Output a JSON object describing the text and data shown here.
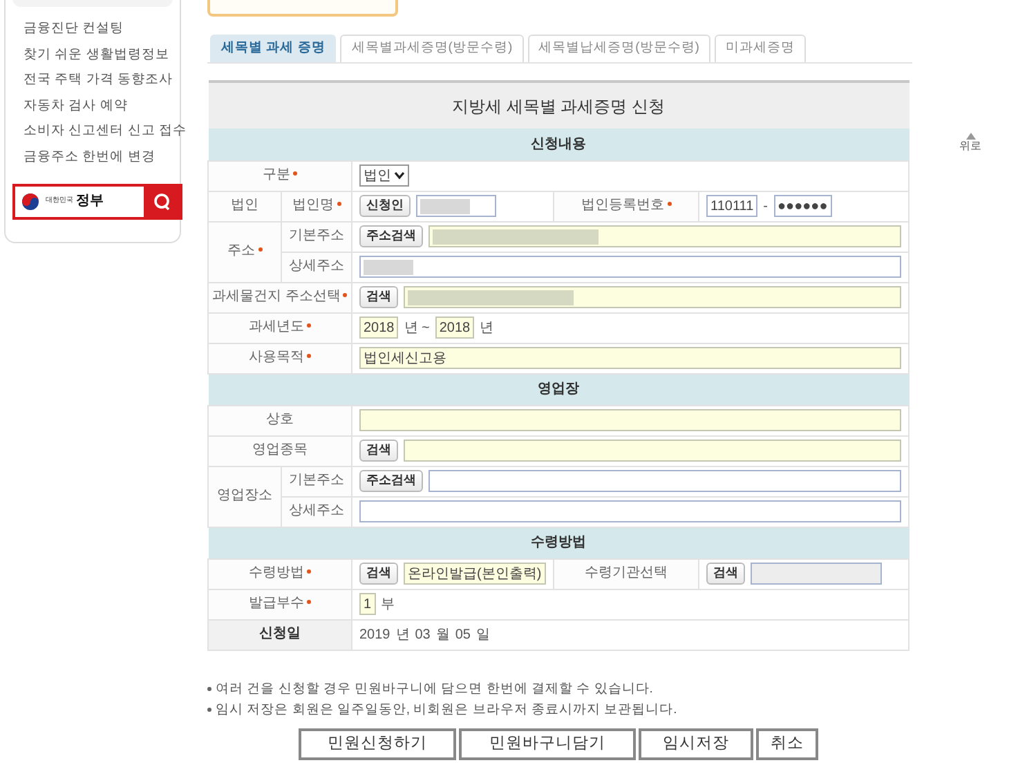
{
  "sidebar": {
    "items": [
      "금융진단 컨설팅",
      "찾기 쉬운 생활법령정보",
      "전국 주택 가격 동향조사",
      "자동차 검사 예약",
      "소비자 신고센터 신고 접수",
      "금융주소 한번에 변경"
    ],
    "gov_search": {
      "logo_small": "대한민국",
      "logo_large": "정부"
    }
  },
  "tabs": [
    {
      "label": "세목별 과세 증명",
      "selected": true
    },
    {
      "label": "세목별과세증명(방문수령)",
      "selected": false
    },
    {
      "label": "세목별납세증명(방문수령)",
      "selected": false
    },
    {
      "label": "미과세증명",
      "selected": false
    }
  ],
  "top_button": {
    "label": "위로"
  },
  "form": {
    "title": "지방세 세목별 과세증명 신청",
    "sections": [
      {
        "heading": "신청내용",
        "rows": [
          {
            "kind": "simple",
            "label": "구분",
            "required": true,
            "fields": [
              {
                "controls": [
                  {
                    "kind": "select",
                    "value": "법인"
                  }
                ]
              }
            ]
          },
          {
            "kind": "group",
            "label": "법인",
            "required": false,
            "children": [
              {
                "label": "법인명",
                "required": true,
                "fields": [
                  {
                    "controls": [
                      {
                        "kind": "button",
                        "text": "신청인"
                      },
                      {
                        "kind": "input",
                        "redacted": true,
                        "highlighted": false,
                        "disabled": false
                      }
                    ]
                  },
                  {
                    "label": "법인등록번호",
                    "required": true,
                    "controls": [
                      {
                        "kind": "input",
                        "value": "110111",
                        "redacted": false,
                        "highlighted": false,
                        "disabled": false
                      },
                      {
                        "kind": "text",
                        "text": "-"
                      },
                      {
                        "kind": "input",
                        "value": "●●●●●●",
                        "redacted": false,
                        "highlighted": false,
                        "disabled": false
                      }
                    ]
                  }
                ]
              }
            ]
          },
          {
            "kind": "group",
            "label": "주소",
            "required": true,
            "children": [
              {
                "label": "기본주소",
                "required": false,
                "fields": [
                  {
                    "controls": [
                      {
                        "kind": "button",
                        "text": "주소검색"
                      },
                      {
                        "kind": "input",
                        "redacted": true,
                        "highlighted": true,
                        "disabled": false
                      }
                    ]
                  }
                ]
              },
              {
                "label": "상세주소",
                "required": false,
                "fields": [
                  {
                    "controls": [
                      {
                        "kind": "input",
                        "redacted": true,
                        "highlighted": false,
                        "disabled": false
                      }
                    ]
                  }
                ]
              }
            ]
          },
          {
            "kind": "simple",
            "label": "과세물건지 주소선택",
            "required": true,
            "fields": [
              {
                "controls": [
                  {
                    "kind": "button",
                    "text": "검색"
                  },
                  {
                    "kind": "input",
                    "redacted": true,
                    "highlighted": true,
                    "disabled": false
                  }
                ]
              }
            ]
          },
          {
            "kind": "simple",
            "label": "과세년도",
            "required": true,
            "fields": [
              {
                "controls": [
                  {
                    "kind": "input",
                    "value": "2018",
                    "redacted": false,
                    "highlighted": true,
                    "disabled": false
                  },
                  {
                    "kind": "text",
                    "text": "년 ~"
                  },
                  {
                    "kind": "input",
                    "value": "2018",
                    "redacted": false,
                    "highlighted": true,
                    "disabled": false
                  },
                  {
                    "kind": "text",
                    "text": "년"
                  }
                ]
              }
            ]
          },
          {
            "kind": "simple",
            "label": "사용목적",
            "required": true,
            "fields": [
              {
                "controls": [
                  {
                    "kind": "input",
                    "value": "법인세신고용",
                    "redacted": false,
                    "highlighted": true,
                    "disabled": false
                  }
                ]
              }
            ]
          }
        ]
      },
      {
        "heading": "영업장",
        "rows": [
          {
            "kind": "simple",
            "label": "상호",
            "required": false,
            "fields": [
              {
                "controls": [
                  {
                    "kind": "input",
                    "redacted": false,
                    "highlighted": true,
                    "disabled": false
                  }
                ]
              }
            ]
          },
          {
            "kind": "simple",
            "label": "영업종목",
            "required": false,
            "fields": [
              {
                "controls": [
                  {
                    "kind": "button",
                    "text": "검색"
                  },
                  {
                    "kind": "input",
                    "redacted": false,
                    "highlighted": true,
                    "disabled": false
                  }
                ]
              }
            ]
          },
          {
            "kind": "group",
            "label": "영업장소",
            "required": false,
            "children": [
              {
                "label": "기본주소",
                "required": false,
                "fields": [
                  {
                    "controls": [
                      {
                        "kind": "button",
                        "text": "주소검색"
                      },
                      {
                        "kind": "input",
                        "redacted": false,
                        "highlighted": false,
                        "disabled": false
                      }
                    ]
                  }
                ]
              },
              {
                "label": "상세주소",
                "required": false,
                "fields": [
                  {
                    "controls": [
                      {
                        "kind": "input",
                        "redacted": false,
                        "highlighted": false,
                        "disabled": false
                      }
                    ]
                  }
                ]
              }
            ]
          }
        ]
      },
      {
        "heading": "수령방법",
        "rows": [
          {
            "kind": "simple",
            "label": "수령방법",
            "required": true,
            "fields": [
              {
                "controls": [
                  {
                    "kind": "button",
                    "text": "검색"
                  },
                  {
                    "kind": "input",
                    "value": "온라인발급(본인출력)",
                    "redacted": false,
                    "highlighted": true,
                    "disabled": false
                  }
                ]
              },
              {
                "label": "수령기관선택",
                "required": false,
                "controls": [
                  {
                    "kind": "button",
                    "text": "검색"
                  },
                  {
                    "kind": "input",
                    "redacted": false,
                    "highlighted": false,
                    "disabled": true
                  }
                ]
              }
            ]
          },
          {
            "kind": "simple",
            "label": "발급부수",
            "required": true,
            "fields": [
              {
                "controls": [
                  {
                    "kind": "input",
                    "value": "1",
                    "redacted": false,
                    "highlighted": true,
                    "disabled": false
                  },
                  {
                    "kind": "text",
                    "text": "부"
                  }
                ]
              }
            ]
          },
          {
            "kind": "date",
            "label": "신청일",
            "required": false,
            "fields": [
              {
                "controls": [
                  {
                    "kind": "text",
                    "text": "2019"
                  },
                  {
                    "kind": "text",
                    "text": "년"
                  },
                  {
                    "kind": "text",
                    "text": "03"
                  },
                  {
                    "kind": "text",
                    "text": "월"
                  },
                  {
                    "kind": "text",
                    "text": "05"
                  },
                  {
                    "kind": "text",
                    "text": "일"
                  }
                ]
              }
            ]
          }
        ]
      }
    ]
  },
  "notes": [
    "여러 건을 신청할 경우 민원바구니에 담으면 한번에 결제할 수 있습니다.",
    "임시 저장은 회원은 일주일동안, 비회원은 브라우저 종료시까지 보관됩니다."
  ],
  "buttons": [
    "민원신청하기",
    "민원바구니담기",
    "임시저장",
    "취소"
  ]
}
